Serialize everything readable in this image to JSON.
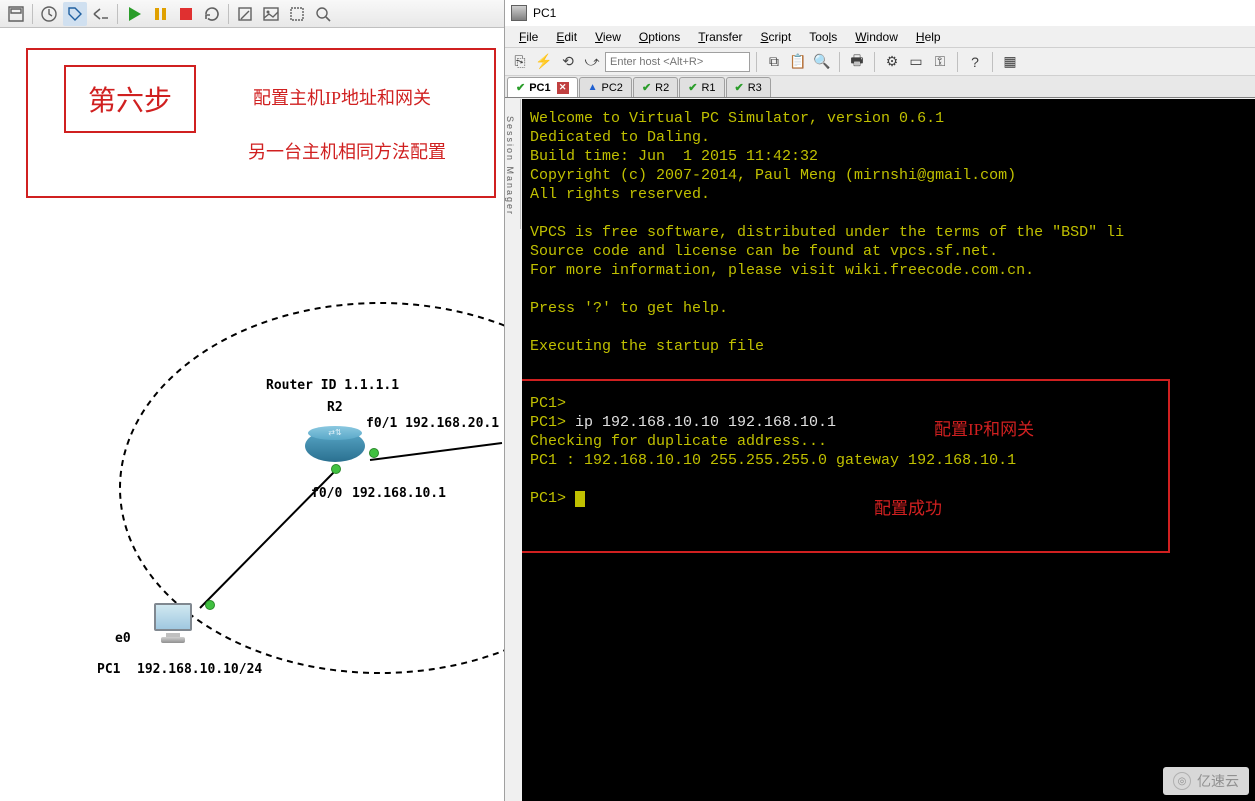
{
  "left": {
    "annotation": {
      "step": "第六步",
      "line1": "配置主机IP地址和网关",
      "line2": "另一台主机相同方法配置"
    },
    "topology": {
      "router_id": "Router ID 1.1.1.1",
      "router_name": "R2",
      "if_f01": "f0/1 192.168.20.1",
      "if_f00": "f0/0",
      "if_f00_ip": "192.168.10.1",
      "pc1_name": "PC1",
      "pc1_if": "e0",
      "pc1_ip": "192.168.10.10/24"
    }
  },
  "right": {
    "title": "PC1",
    "menus": [
      "File",
      "Edit",
      "View",
      "Options",
      "Transfer",
      "Script",
      "Tools",
      "Window",
      "Help"
    ],
    "host_placeholder": "Enter host <Alt+R>",
    "tabs": [
      {
        "label": "PC1",
        "status": "ok",
        "active": true,
        "closeable": true
      },
      {
        "label": "PC2",
        "status": "warn"
      },
      {
        "label": "R2",
        "status": "ok"
      },
      {
        "label": "R1",
        "status": "ok"
      },
      {
        "label": "R3",
        "status": "ok"
      }
    ],
    "session_mgr": "Session Manager",
    "terminal": {
      "l1": "Welcome to Virtual PC Simulator, version 0.6.1",
      "l2": "Dedicated to Daling.",
      "l3": "Build time: Jun  1 2015 11:42:32",
      "l4": "Copyright (c) 2007-2014, Paul Meng (mirnshi@gmail.com)",
      "l5": "All rights reserved.",
      "l6": "VPCS is free software, distributed under the terms of the \"BSD\" li",
      "l7": "Source code and license can be found at vpcs.sf.net.",
      "l8": "For more information, please visit wiki.freecode.com.cn.",
      "l9": "Press '?' to get help.",
      "l10": "Executing the startup file",
      "p1": "PC1>",
      "p2a": "PC1> ",
      "p2b": "ip 192.168.10.10 192.168.10.1",
      "p3": "Checking for duplicate address...",
      "p4": "PC1 : 192.168.10.10 255.255.255.0 gateway 192.168.10.1",
      "p5": "PC1> ",
      "ann1": "配置IP和网关",
      "ann2": "配置成功"
    }
  },
  "watermark": "亿速云"
}
